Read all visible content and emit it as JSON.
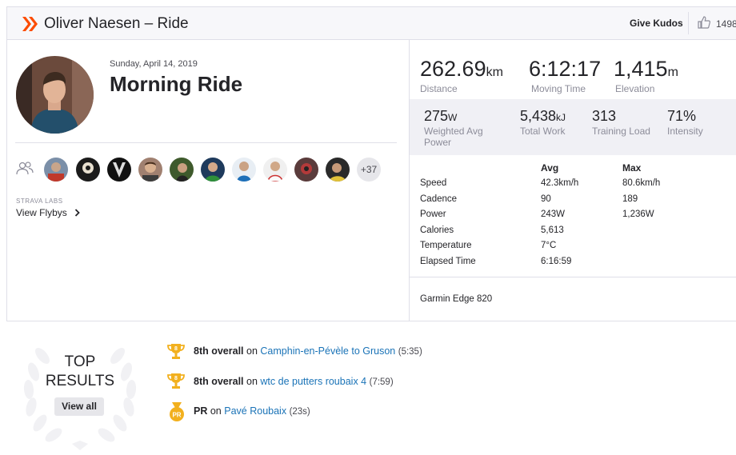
{
  "header": {
    "title": "Oliver Naesen – Ride",
    "kudos_label": "Give Kudos",
    "kudos_count": "1498"
  },
  "activity": {
    "date": "Sunday, April 14, 2019",
    "title": "Morning Ride",
    "others_count": "+37",
    "labs_label": "STRAVA LABS",
    "flybys_label": "View Flybys"
  },
  "primary_stats": [
    {
      "value": "262.69",
      "unit": "km",
      "label": "Distance"
    },
    {
      "value": "6:12:17",
      "unit": "",
      "label": "Moving Time"
    },
    {
      "value": "1,415",
      "unit": "m",
      "label": "Elevation"
    }
  ],
  "secondary_stats": [
    {
      "value": "275",
      "unit": "W",
      "label_line1": "Weighted Avg",
      "label_line2": "Power"
    },
    {
      "value": "5,438",
      "unit": "kJ",
      "label_line1": "Total Work",
      "label_line2": ""
    },
    {
      "value": "313",
      "unit": "",
      "label_line1": "Training Load",
      "label_line2": ""
    },
    {
      "value": "71%",
      "unit": "",
      "label_line1": "Intensity",
      "label_line2": ""
    }
  ],
  "table": {
    "headers": {
      "avg": "Avg",
      "max": "Max"
    },
    "rows": [
      {
        "label": "Speed",
        "avg": "42.3km/h",
        "max": "80.6km/h"
      },
      {
        "label": "Cadence",
        "avg": "90",
        "max": "189"
      },
      {
        "label": "Power",
        "avg": "243W",
        "max": "1,236W"
      },
      {
        "label": "Calories",
        "avg": "5,613",
        "max": ""
      },
      {
        "label": "Temperature",
        "avg": "7°C",
        "max": ""
      },
      {
        "label": "Elapsed Time",
        "avg": "6:16:59",
        "max": ""
      }
    ]
  },
  "device": "Garmin Edge 820",
  "top_results": {
    "title_line1": "TOP",
    "title_line2": "RESULTS",
    "view_all": "View all",
    "items": [
      {
        "badge": "trophy",
        "rank": "8th overall",
        "on": "on",
        "segment": "Camphin-en-Pévèle to Gruson",
        "time": "(5:35)"
      },
      {
        "badge": "trophy",
        "rank": "8th overall",
        "on": "on",
        "segment": "wtc de putters roubaix 4",
        "time": "(7:59)"
      },
      {
        "badge": "pr-medal",
        "rank": "PR",
        "on": "on",
        "segment": "Pavé Roubaix",
        "time": "(23s)"
      }
    ]
  },
  "colors": {
    "brand": "#fc4c02",
    "link": "#1a73b7",
    "gold": "#f2b01e"
  }
}
